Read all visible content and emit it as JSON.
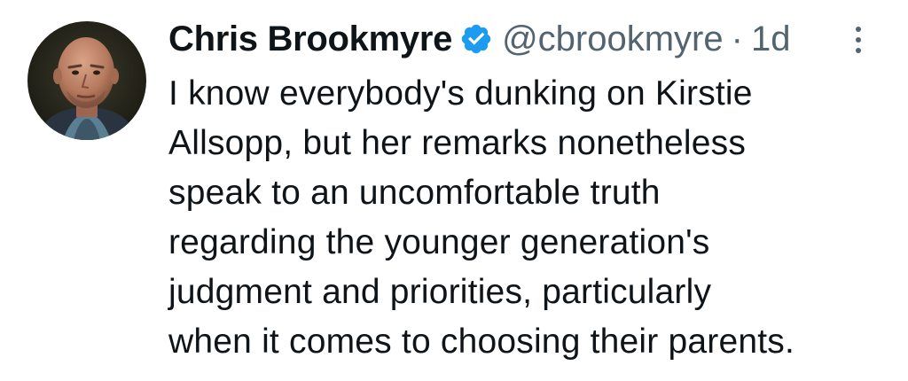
{
  "tweet": {
    "author_name": "Chris Brookmyre",
    "handle": "@cbrookmyre",
    "separator": "·",
    "time": "1d",
    "verified": true,
    "text_lines": [
      "I know everybody's dunking on Kirstie",
      "Allsopp, but her remarks nonetheless",
      "speak to an uncomfortable truth",
      "regarding the younger generation's",
      "judgment and priorities, particularly",
      "when it comes to choosing their parents."
    ]
  },
  "colors": {
    "text": "#0f1419",
    "secondary": "#536471",
    "verified_badge": "#1d9bf0"
  },
  "icons": {
    "verified": "verified-badge-icon",
    "more": "more-options-icon"
  }
}
